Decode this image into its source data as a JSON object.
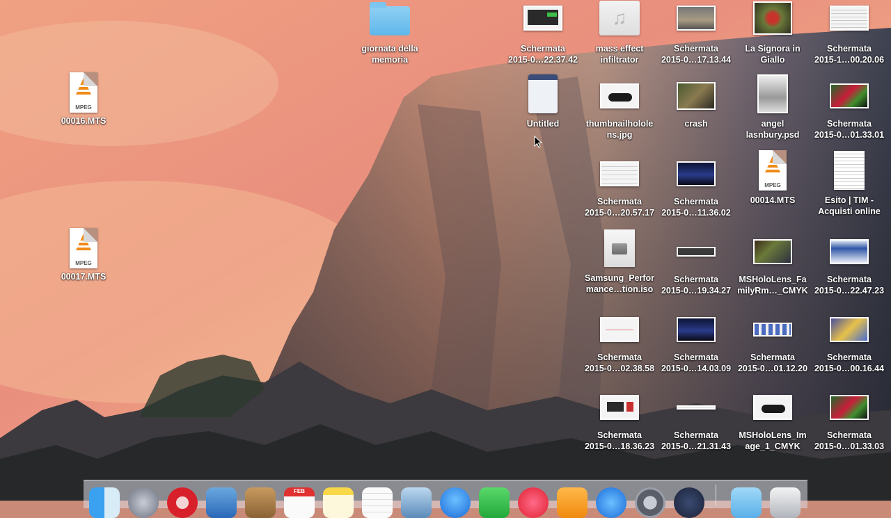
{
  "desktop": {
    "icons": [
      {
        "id": "giornata",
        "line1": "giornata della",
        "line2": "memoria"
      },
      {
        "id": "s1",
        "line1": "Schermata",
        "line2": "2015-0…22.37.42"
      },
      {
        "id": "mass",
        "line1": "mass effect",
        "line2": "infiltrator"
      },
      {
        "id": "s2",
        "line1": "Schermata",
        "line2": "2015-0…17.13.44"
      },
      {
        "id": "signora",
        "line1": "La Signora in",
        "line2": "Giallo"
      },
      {
        "id": "s3",
        "line1": "Schermata",
        "line2": "2015-1…00.20.06"
      },
      {
        "id": "m16",
        "line1": "00016.MTS",
        "line2": ""
      },
      {
        "id": "untitled",
        "line1": "Untitled",
        "line2": ""
      },
      {
        "id": "thumb",
        "line1": "thumbnailholole",
        "line2": "ns.jpg"
      },
      {
        "id": "crash",
        "line1": "crash",
        "line2": ""
      },
      {
        "id": "angel",
        "line1": "angel",
        "line2": "lasnbury.psd"
      },
      {
        "id": "s4",
        "line1": "Schermata",
        "line2": "2015-0…01.33.01"
      },
      {
        "id": "s5",
        "line1": "Schermata",
        "line2": "2015-0…20.57.17"
      },
      {
        "id": "s6",
        "line1": "Schermata",
        "line2": "2015-0…11.36.02"
      },
      {
        "id": "m14",
        "line1": "00014.MTS",
        "line2": ""
      },
      {
        "id": "esito",
        "line1": "Esito | TIM -",
        "line2": "Acquisti online"
      },
      {
        "id": "m17",
        "line1": "00017.MTS",
        "line2": ""
      },
      {
        "id": "samsung",
        "line1": "Samsung_Perfor",
        "line2": "mance…tion.iso"
      },
      {
        "id": "s7",
        "line1": "Schermata",
        "line2": "2015-0…19.34.27"
      },
      {
        "id": "msfam",
        "line1": "MSHoloLens_Fa",
        "line2": "milyRm…_CMYK"
      },
      {
        "id": "s8",
        "line1": "Schermata",
        "line2": "2015-0…22.47.23"
      },
      {
        "id": "s9",
        "line1": "Schermata",
        "line2": "2015-0…02.38.58"
      },
      {
        "id": "s10",
        "line1": "Schermata",
        "line2": "2015-0…14.03.09"
      },
      {
        "id": "s11",
        "line1": "Schermata",
        "line2": "2015-0…01.12.20"
      },
      {
        "id": "s12",
        "line1": "Schermata",
        "line2": "2015-0…00.16.44"
      },
      {
        "id": "s13",
        "line1": "Schermata",
        "line2": "2015-0…18.36.23"
      },
      {
        "id": "s14",
        "line1": "Schermata",
        "line2": "2015-0…21.31.43"
      },
      {
        "id": "msimg",
        "line1": "MSHoloLens_Im",
        "line2": "age_1_CMYK"
      },
      {
        "id": "s15",
        "line1": "Schermata",
        "line2": "2015-0…01.33.03"
      }
    ],
    "mpeg_badge": "MPEG"
  },
  "dock": {
    "calendar_month": "FEB",
    "apps": [
      "finder",
      "launchpad",
      "opera",
      "mail",
      "contacts",
      "calendar",
      "notes",
      "reminders",
      "preview",
      "app-blue",
      "facetime",
      "itunes",
      "ibooks",
      "app-store",
      "system-preferences",
      "quicktime",
      "downloads",
      "trash"
    ]
  },
  "colors": {
    "sky_top": "#e98f7e",
    "sky_bottom": "#f2b07a",
    "rock_light": "#c8a08a",
    "rock_dark": "#4a4a52",
    "folder": "#6cbfee",
    "dock_bg": "rgba(220,220,228,0.55)"
  }
}
